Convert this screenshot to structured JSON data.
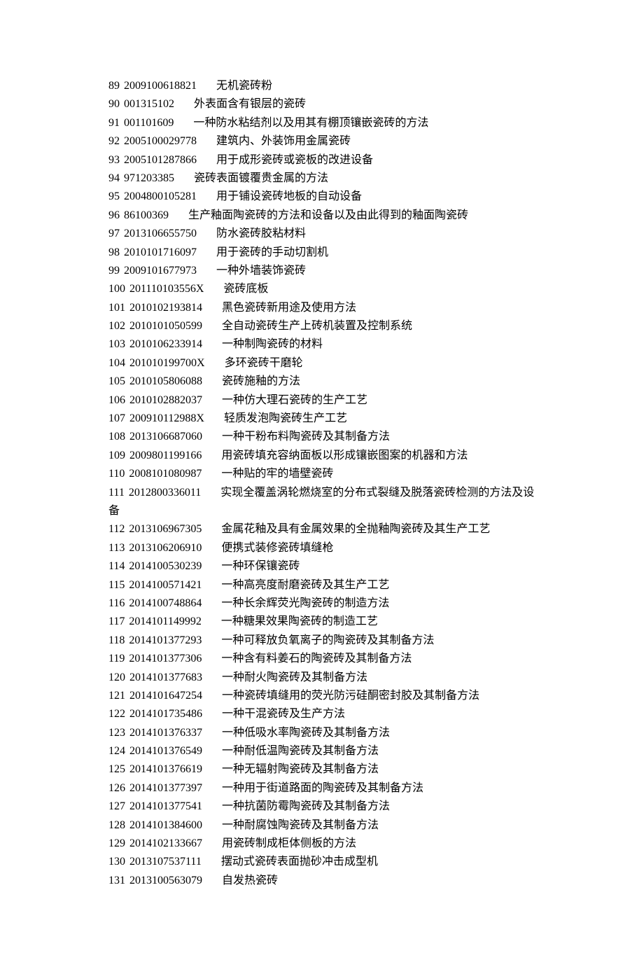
{
  "rows": [
    {
      "idx": "89",
      "code": "2009100618821",
      "title": "无机瓷砖粉"
    },
    {
      "idx": "90",
      "code": "001315102",
      "title": "外表面含有银层的瓷砖"
    },
    {
      "idx": "91",
      "code": "001101609",
      "title": "一种防水粘结剂以及用其有棚顶镶嵌瓷砖的方法"
    },
    {
      "idx": "92",
      "code": "2005100029778",
      "title": "建筑内、外装饰用金属瓷砖"
    },
    {
      "idx": "93",
      "code": "2005101287866",
      "title": "用于成形瓷砖或瓷板的改进设备"
    },
    {
      "idx": "94",
      "code": "971203385",
      "title": "瓷砖表面镀覆贵金属的方法"
    },
    {
      "idx": "95",
      "code": "2004800105281",
      "title": "用于铺设瓷砖地板的自动设备"
    },
    {
      "idx": "96",
      "code": "86100369",
      "title": "生产釉面陶瓷砖的方法和设备以及由此得到的釉面陶瓷砖"
    },
    {
      "idx": "97",
      "code": "2013106655750",
      "title": "防水瓷砖胶粘材料"
    },
    {
      "idx": "98",
      "code": "2010101716097",
      "title": "用于瓷砖的手动切割机"
    },
    {
      "idx": "99",
      "code": "2009101677973",
      "title": "一种外墙装饰瓷砖"
    },
    {
      "idx": "100",
      "code": "201110103556X",
      "title": "瓷砖底板"
    },
    {
      "idx": "101",
      "code": "2010102193814",
      "title": "黑色瓷砖新用途及使用方法"
    },
    {
      "idx": "102",
      "code": "2010101050599",
      "title": "全自动瓷砖生产上砖机装置及控制系统"
    },
    {
      "idx": "103",
      "code": "2010106233914",
      "title": "一种制陶瓷砖的材料"
    },
    {
      "idx": "104",
      "code": "201010199700X",
      "title": "多环瓷砖干磨轮"
    },
    {
      "idx": "105",
      "code": "2010105806088",
      "title": "瓷砖施釉的方法"
    },
    {
      "idx": "106",
      "code": "2010102882037",
      "title": "一种仿大理石瓷砖的生产工艺"
    },
    {
      "idx": "107",
      "code": "200910112988X",
      "title": "轻质发泡陶瓷砖生产工艺"
    },
    {
      "idx": "108",
      "code": "2013106687060",
      "title": "一种干粉布料陶瓷砖及其制备方法"
    },
    {
      "idx": "109",
      "code": "2009801199166",
      "title": "用瓷砖填充容纳面板以形成镶嵌图案的机器和方法"
    },
    {
      "idx": "110",
      "code": "2008101080987",
      "title": "一种贴的牢的墙壁瓷砖"
    },
    {
      "idx": "111",
      "code": "2012800336011",
      "title": "实现全覆盖涡轮燃烧室的分布式裂缝及脱落瓷砖检测的方法及设",
      "cont": "备"
    },
    {
      "idx": "112",
      "code": "2013106967305",
      "title": "金属花釉及具有金属效果的全抛釉陶瓷砖及其生产工艺"
    },
    {
      "idx": "113",
      "code": "2013106206910",
      "title": "便携式装修瓷砖填缝枪"
    },
    {
      "idx": "114",
      "code": "2014100530239",
      "title": "一种环保镶瓷砖"
    },
    {
      "idx": "115",
      "code": "2014100571421",
      "title": "一种高亮度耐磨瓷砖及其生产工艺"
    },
    {
      "idx": "116",
      "code": "2014100748864",
      "title": "一种长余辉荧光陶瓷砖的制造方法"
    },
    {
      "idx": "117",
      "code": "2014101149992",
      "title": "一种糖果效果陶瓷砖的制造工艺"
    },
    {
      "idx": "118",
      "code": "2014101377293",
      "title": "一种可释放负氧离子的陶瓷砖及其制备方法"
    },
    {
      "idx": "119",
      "code": "2014101377306",
      "title": "一种含有料姜石的陶瓷砖及其制备方法"
    },
    {
      "idx": "120",
      "code": "2014101377683",
      "title": "一种耐火陶瓷砖及其制备方法"
    },
    {
      "idx": "121",
      "code": "2014101647254",
      "title": "一种瓷砖填缝用的荧光防污硅酮密封胶及其制备方法"
    },
    {
      "idx": "122",
      "code": "2014101735486",
      "title": "一种干混瓷砖及生产方法"
    },
    {
      "idx": "123",
      "code": "2014101376337",
      "title": "一种低吸水率陶瓷砖及其制备方法"
    },
    {
      "idx": "124",
      "code": "2014101376549",
      "title": "一种耐低温陶瓷砖及其制备方法"
    },
    {
      "idx": "125",
      "code": "2014101376619",
      "title": "一种无辐射陶瓷砖及其制备方法"
    },
    {
      "idx": "126",
      "code": "2014101377397",
      "title": "一种用于街道路面的陶瓷砖及其制备方法"
    },
    {
      "idx": "127",
      "code": "2014101377541",
      "title": "一种抗菌防霉陶瓷砖及其制备方法"
    },
    {
      "idx": "128",
      "code": "2014101384600",
      "title": "一种耐腐蚀陶瓷砖及其制备方法"
    },
    {
      "idx": "129",
      "code": "2014102133667",
      "title": "用瓷砖制成柜体侧板的方法"
    },
    {
      "idx": "130",
      "code": "2013107537111",
      "title": "摆动式瓷砖表面抛砂冲击成型机"
    },
    {
      "idx": "131",
      "code": "2013100563079",
      "title": "自发热瓷砖"
    }
  ]
}
